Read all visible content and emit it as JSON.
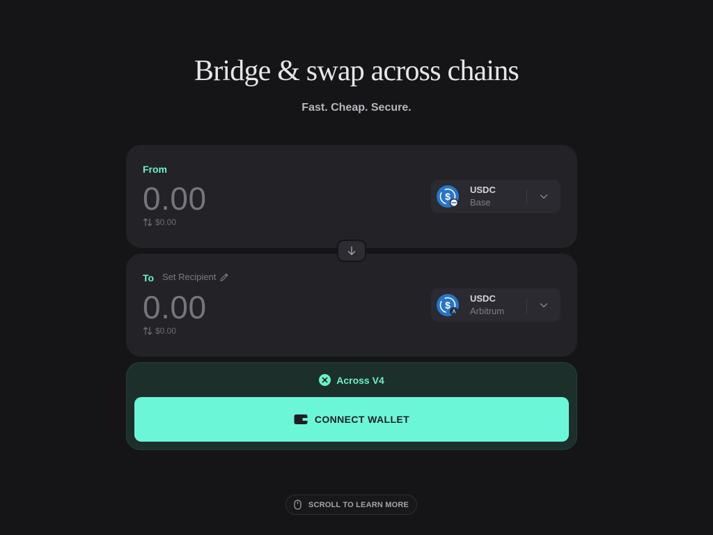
{
  "hero": {
    "title": "Bridge & swap across chains",
    "subtitle": "Fast. Cheap. Secure."
  },
  "from": {
    "label": "From",
    "amount": "0.00",
    "usd_value": "$0.00",
    "token": {
      "symbol": "USDC",
      "chain": "Base"
    }
  },
  "to": {
    "label": "To",
    "set_recipient": "Set Recipient",
    "amount": "0.00",
    "usd_value": "$0.00",
    "token": {
      "symbol": "USDC",
      "chain": "Arbitrum"
    }
  },
  "route": {
    "label": "Across V4"
  },
  "actions": {
    "connect_wallet": "CONNECT WALLET"
  },
  "footer": {
    "scroll_hint": "SCROLL TO LEARN MORE"
  },
  "icons": {
    "token": "usdc-icon",
    "from_chain_badge": "base-chain-icon",
    "to_chain_badge": "arbitrum-chain-icon",
    "swap": "arrow-down-icon",
    "route": "across-logo-icon",
    "wallet": "wallet-icon",
    "scroll": "mouse-icon"
  },
  "colors": {
    "accent": "#6cf2c8",
    "button": "#6cf6d8",
    "background": "#151518",
    "card": "#222227",
    "usdc_blue": "#2775ca"
  }
}
